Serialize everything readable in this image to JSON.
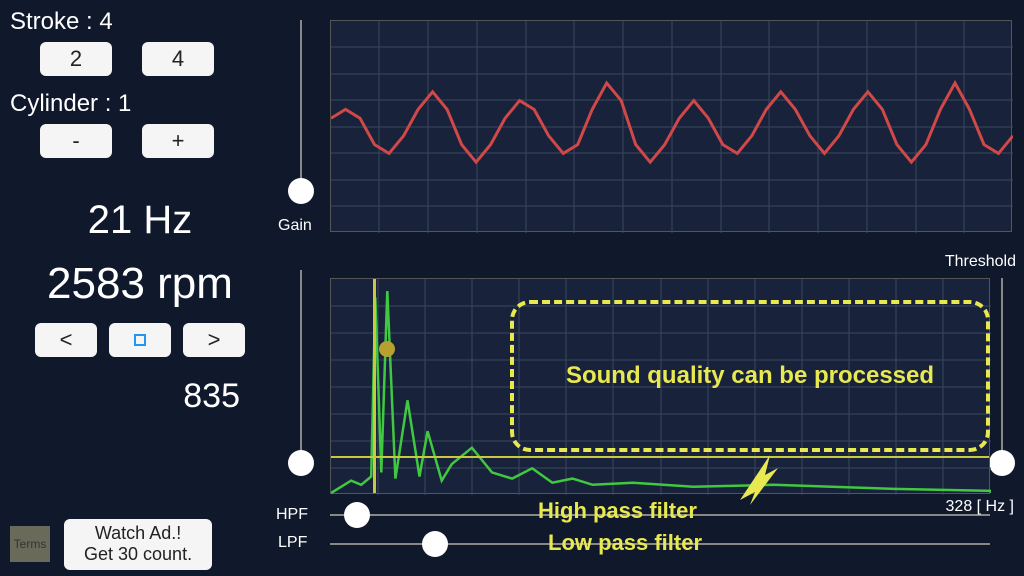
{
  "stroke": {
    "label": "Stroke : 4",
    "opt2": "2",
    "opt4": "4"
  },
  "cylinder": {
    "label": "Cylinder : 1",
    "minus": "-",
    "plus": "+"
  },
  "freq": "21 Hz",
  "rpm": "2583 rpm",
  "nav": {
    "prev": "<",
    "next": ">"
  },
  "count": "835",
  "terms": "Terms",
  "ad": {
    "line1": "Watch Ad.!",
    "line2": "Get 30 count."
  },
  "gain_label": "Gain",
  "threshold_label": "Threshold",
  "hpf_label": "HPF",
  "lpf_label": "LPF",
  "freq_max": "328 [ Hz ]",
  "annotation": "Sound quality can be processed",
  "hpf_annotation": "High pass filter",
  "lpf_annotation": "Low pass filter",
  "chart_data": [
    {
      "type": "line",
      "title": "waveform",
      "xlim": [
        0,
        100
      ],
      "ylim": [
        -1,
        1
      ],
      "series": [
        {
          "name": "signal",
          "color": "#d04040",
          "values": [
            0.05,
            0.1,
            0.05,
            -0.1,
            -0.15,
            -0.05,
            0.1,
            0.2,
            0.1,
            -0.1,
            -0.2,
            -0.1,
            0.05,
            0.15,
            0.1,
            -0.05,
            -0.15,
            -0.1,
            0.1,
            0.25,
            0.15,
            -0.1,
            -0.2,
            -0.1,
            0.05,
            0.15,
            0.05,
            -0.1,
            -0.15,
            -0.05,
            0.1,
            0.2,
            0.1,
            -0.05,
            -0.15,
            -0.05,
            0.1,
            0.2,
            0.1,
            -0.1,
            -0.2,
            -0.1,
            0.1,
            0.25,
            0.1,
            -0.1,
            -0.15,
            -0.05
          ]
        }
      ]
    },
    {
      "type": "line",
      "title": "spectrum",
      "xlabel": "Hz",
      "xlim": [
        0,
        328
      ],
      "ylim": [
        0,
        1
      ],
      "threshold": 0.18,
      "hpf_cutoff": 21,
      "lpf_cutoff": 55,
      "series": [
        {
          "name": "spectrum",
          "color": "#40c040",
          "x": [
            5,
            10,
            15,
            20,
            22,
            25,
            28,
            32,
            38,
            44,
            48,
            55,
            60,
            70,
            80,
            90,
            100,
            110,
            120,
            130,
            150,
            180,
            220,
            280,
            328
          ],
          "values": [
            0.03,
            0.06,
            0.04,
            0.08,
            0.95,
            0.1,
            0.98,
            0.07,
            0.45,
            0.08,
            0.3,
            0.06,
            0.14,
            0.22,
            0.1,
            0.07,
            0.12,
            0.05,
            0.07,
            0.04,
            0.05,
            0.03,
            0.04,
            0.02,
            0.01
          ]
        }
      ]
    }
  ]
}
